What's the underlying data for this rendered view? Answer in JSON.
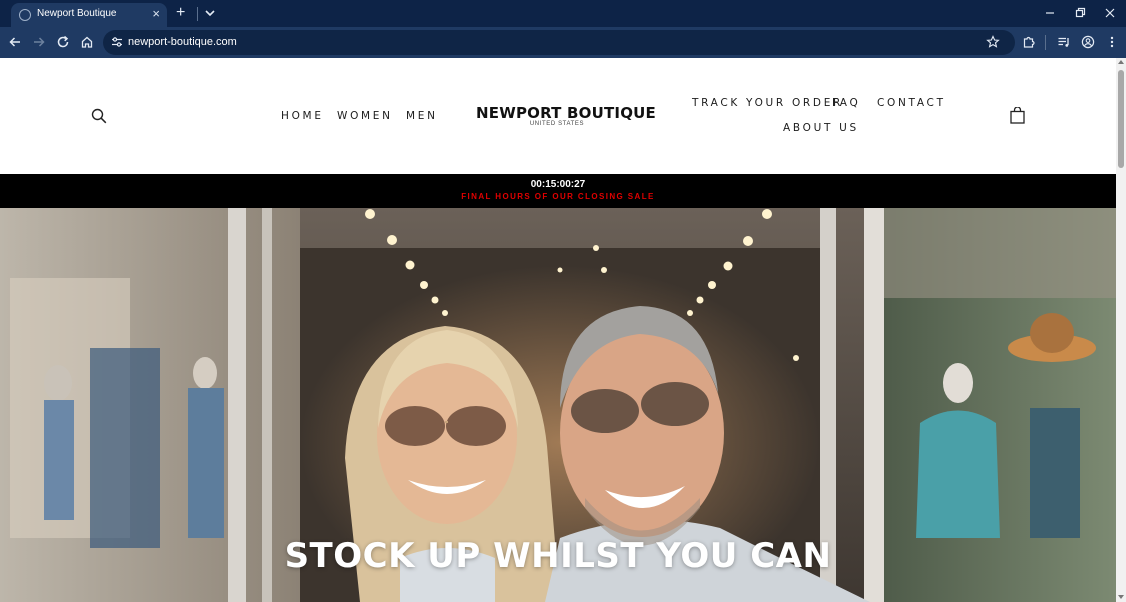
{
  "browser": {
    "tab_title": "Newport Boutique",
    "url": "newport-boutique.com",
    "icons": {
      "favicon": "globe-icon",
      "tab_close": "close-icon",
      "new_tab": "plus-icon",
      "tab_search": "chevron-down-icon",
      "minimize": "minimize-icon",
      "restore": "restore-icon",
      "close": "close-icon",
      "back": "arrow-left-icon",
      "forward": "arrow-right-icon",
      "reload": "reload-icon",
      "home": "home-icon",
      "site_info": "tune-icon",
      "bookmark": "star-icon",
      "extensions": "puzzle-icon",
      "media": "playlist-icon",
      "profile": "account-icon",
      "menu": "kebab-menu-icon"
    },
    "colors": {
      "tab_strip": "#0d2347",
      "toolbar": "#1f3a63",
      "omnibox": "#0f2546"
    }
  },
  "header": {
    "nav_left": [
      "HOME",
      "WOMEN",
      "MEN"
    ],
    "logo_name": "NEWPORT BOUTIQUE",
    "logo_sub": "UNITED STATES",
    "nav_right_top": [
      "TRACK YOUR ORDER",
      "FAQ",
      "CONTACT"
    ],
    "nav_right_bottom": [
      "ABOUT US"
    ],
    "icons": {
      "search": "search-icon",
      "cart": "shopping-bag-icon"
    }
  },
  "announcement": {
    "timer": "00:15:00:27",
    "text": "FINAL HOURS OF OUR CLOSING SALE",
    "colors": {
      "background": "#000000",
      "timer": "#ffffff",
      "text": "#e00000"
    }
  },
  "hero": {
    "headline": "STOCK UP WHILST YOU CAN",
    "image": "smiling-couple-in-sunglasses-at-boutique-entrance"
  }
}
